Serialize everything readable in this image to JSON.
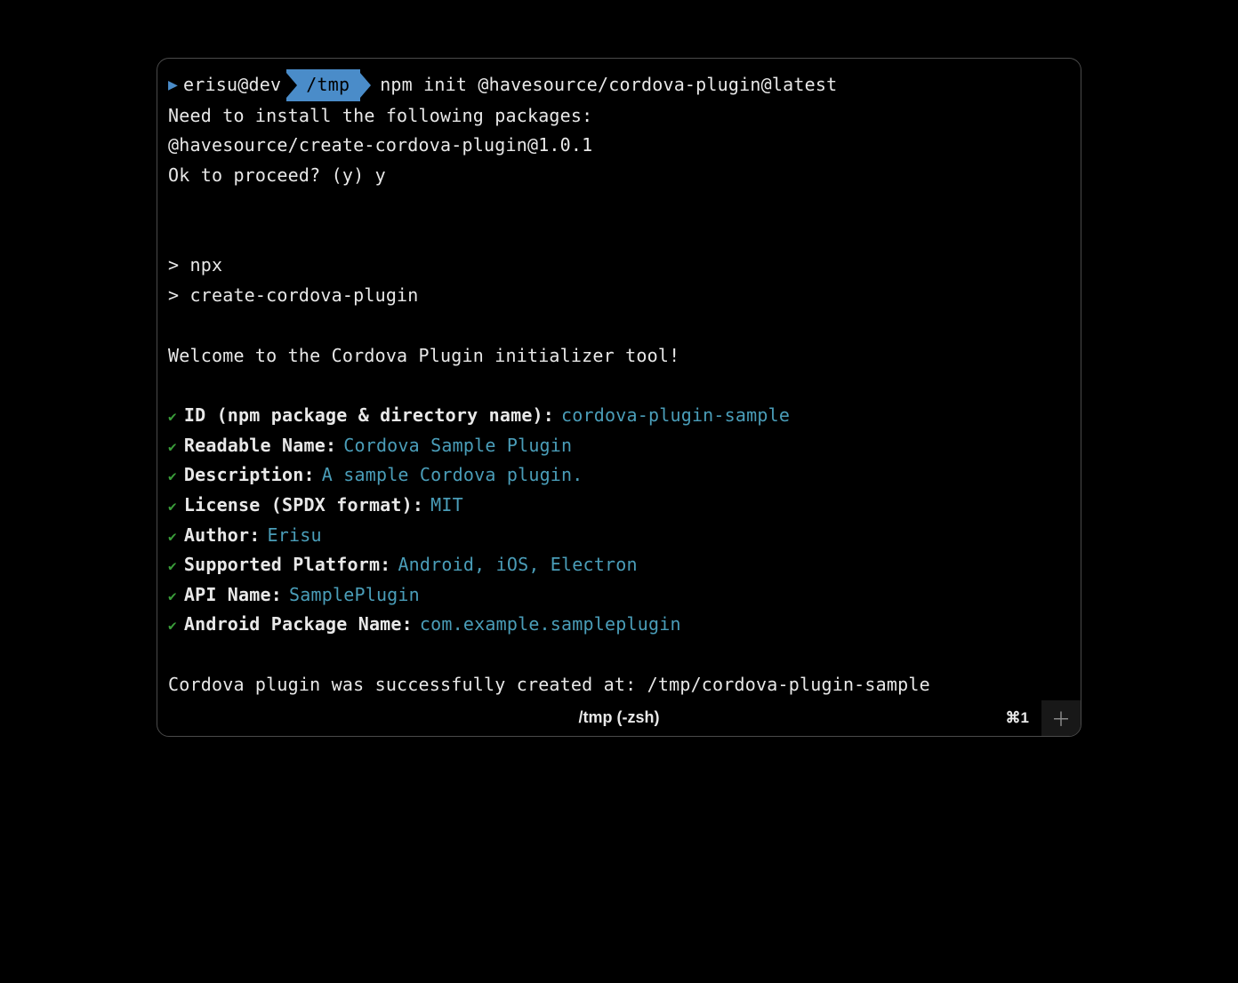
{
  "prompt": {
    "user": "erisu@dev",
    "dir": "/tmp",
    "command": "npm init @havesource/cordova-plugin@latest"
  },
  "install": {
    "line1": "Need to install the following packages:",
    "line2": "@havesource/create-cordova-plugin@1.0.1",
    "line3": "Ok to proceed? (y) y"
  },
  "npx": {
    "line1": "> npx",
    "line2": "> create-cordova-plugin"
  },
  "welcome": "Welcome to the Cordova Plugin initializer tool!",
  "prompts": [
    {
      "label": "ID (npm package & directory name):",
      "value": "cordova-plugin-sample"
    },
    {
      "label": "Readable Name:",
      "value": "Cordova Sample Plugin"
    },
    {
      "label": "Description:",
      "value": "A sample Cordova plugin."
    },
    {
      "label": "License (SPDX format):",
      "value": "MIT"
    },
    {
      "label": "Author:",
      "value": "Erisu"
    },
    {
      "label": "Supported Platform:",
      "value": "Android, iOS, Electron"
    },
    {
      "label": "API Name:",
      "value": "SamplePlugin"
    },
    {
      "label": "Android Package Name:",
      "value": "com.example.sampleplugin"
    }
  ],
  "success": "Cordova plugin was successfully created at: /tmp/cordova-plugin-sample",
  "tabbar": {
    "title": "/tmp (-zsh)",
    "shortcut": "⌘1"
  }
}
